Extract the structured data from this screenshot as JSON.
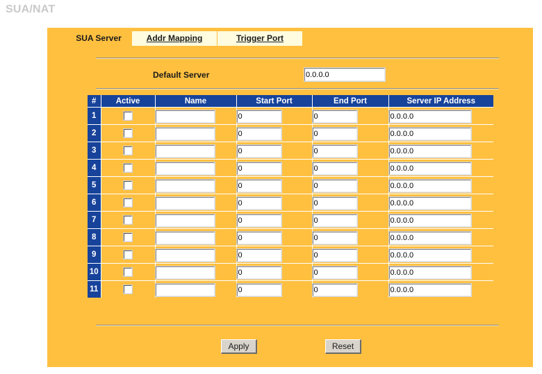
{
  "page": {
    "title": "SUA/NAT",
    "accent_orange": "#ffc040",
    "header_blue": "#17439b",
    "tab_inactive_bg": "#fffce0",
    "title_color": "#c9c9c9"
  },
  "tabs": [
    {
      "label": "SUA Server",
      "active": true
    },
    {
      "label": "Addr Mapping",
      "active": false
    },
    {
      "label": "Trigger Port",
      "active": false
    }
  ],
  "default_server": {
    "label": "Default Server",
    "value": "0.0.0.0",
    "placeholder": ""
  },
  "table": {
    "columns": [
      "#",
      "Active",
      "Name",
      "Start Port",
      "End Port",
      "Server IP Address"
    ],
    "rows": [
      {
        "index": "1",
        "active": false,
        "name": "",
        "start_port": "0",
        "end_port": "0",
        "server_ip": "0.0.0.0"
      },
      {
        "index": "2",
        "active": false,
        "name": "",
        "start_port": "0",
        "end_port": "0",
        "server_ip": "0.0.0.0"
      },
      {
        "index": "3",
        "active": false,
        "name": "",
        "start_port": "0",
        "end_port": "0",
        "server_ip": "0.0.0.0"
      },
      {
        "index": "4",
        "active": false,
        "name": "",
        "start_port": "0",
        "end_port": "0",
        "server_ip": "0.0.0.0"
      },
      {
        "index": "5",
        "active": false,
        "name": "",
        "start_port": "0",
        "end_port": "0",
        "server_ip": "0.0.0.0"
      },
      {
        "index": "6",
        "active": false,
        "name": "",
        "start_port": "0",
        "end_port": "0",
        "server_ip": "0.0.0.0"
      },
      {
        "index": "7",
        "active": false,
        "name": "",
        "start_port": "0",
        "end_port": "0",
        "server_ip": "0.0.0.0"
      },
      {
        "index": "8",
        "active": false,
        "name": "",
        "start_port": "0",
        "end_port": "0",
        "server_ip": "0.0.0.0"
      },
      {
        "index": "9",
        "active": false,
        "name": "",
        "start_port": "0",
        "end_port": "0",
        "server_ip": "0.0.0.0"
      },
      {
        "index": "10",
        "active": false,
        "name": "",
        "start_port": "0",
        "end_port": "0",
        "server_ip": "0.0.0.0"
      },
      {
        "index": "11",
        "active": false,
        "name": "",
        "start_port": "0",
        "end_port": "0",
        "server_ip": "0.0.0.0"
      }
    ]
  },
  "buttons": {
    "apply_label": "Apply",
    "reset_label": "Reset"
  }
}
